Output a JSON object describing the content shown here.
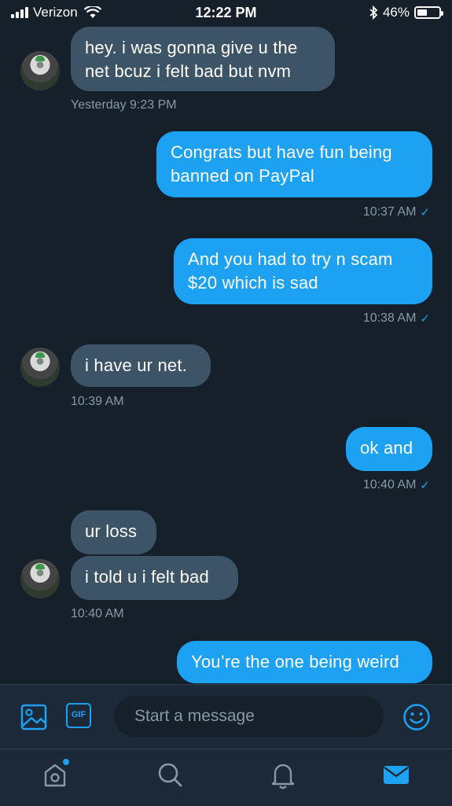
{
  "status_bar": {
    "carrier": "Verizon",
    "time": "12:22 PM",
    "battery": "46%",
    "battery_level": 0.46
  },
  "messages": [
    {
      "direction": "in",
      "text_lines": [
        "hey. i was gonna give u the",
        "net bcuz i felt bad but nvm"
      ],
      "timestamp": "Yesterday 9:23 PM"
    },
    {
      "direction": "out",
      "text_lines": [
        "Congrats but have fun being",
        "banned on PayPal"
      ],
      "timestamp": "10:37 AM"
    },
    {
      "direction": "out",
      "text_lines": [
        "And you had to try n scam",
        "$20 which is sad"
      ],
      "timestamp": "10:38 AM"
    },
    {
      "direction": "in",
      "text_lines": [
        "i have ur net."
      ],
      "timestamp": "10:39 AM"
    },
    {
      "direction": "out",
      "text_lines": [
        "ok and"
      ],
      "timestamp": "10:40 AM"
    },
    {
      "direction": "in",
      "text_lines": [
        "ur loss"
      ],
      "timestamp": ""
    },
    {
      "direction": "in",
      "text_lines": [
        "i told u i felt bad"
      ],
      "timestamp": "10:40 AM"
    },
    {
      "direction": "out",
      "text_lines": [
        "You’re the one being weird"
      ],
      "timestamp": ""
    }
  ],
  "composer": {
    "placeholder": "Start a message",
    "gif_label": "GIF"
  },
  "icons": {
    "image": "image-icon",
    "gif": "gif-icon",
    "emoji": "emoji-icon",
    "home": "home-icon",
    "search": "search-icon",
    "notifications": "bell-icon",
    "messages": "mail-icon"
  },
  "colors": {
    "background": "#15202b",
    "incoming_bubble": "#3d5466",
    "outgoing_bubble": "#1da1f2",
    "timestamp": "#8899a6",
    "accent": "#1da1f2"
  }
}
